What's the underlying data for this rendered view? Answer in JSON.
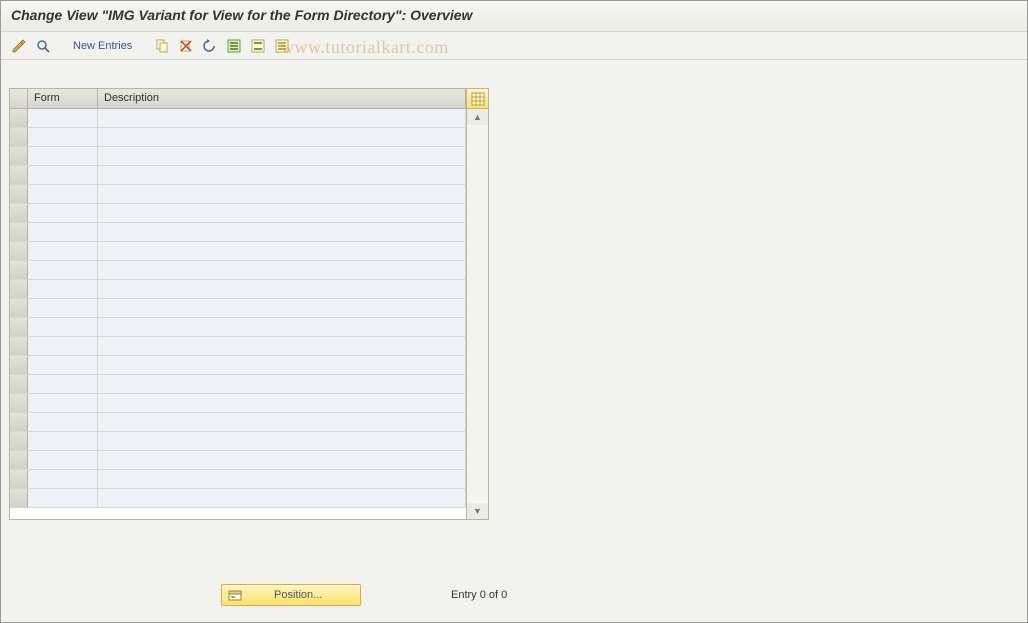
{
  "title": "Change View \"IMG Variant for View for the Form Directory\": Overview",
  "toolbar": {
    "new_entries_label": "New Entries"
  },
  "watermark": "www.tutorialkart.com",
  "grid": {
    "columns": {
      "form": "Form",
      "description": "Description"
    },
    "row_count": 21
  },
  "footer": {
    "position_label": "Position...",
    "entry_status": "Entry 0 of 0"
  }
}
